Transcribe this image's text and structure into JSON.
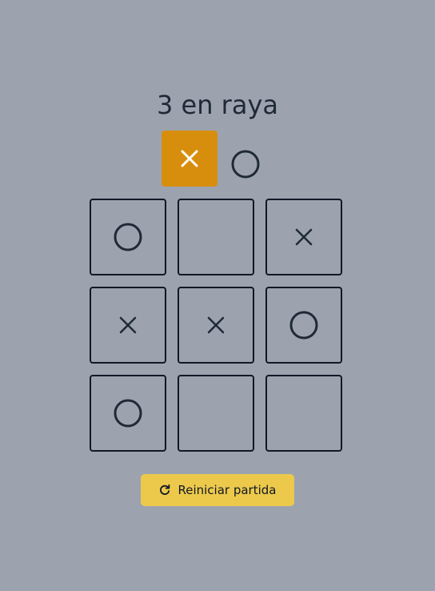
{
  "title": "3 en raya",
  "turn": {
    "current": "X",
    "players": [
      "X",
      "O"
    ],
    "active_color": "#d88e0d"
  },
  "board": [
    "O",
    "",
    "X",
    "X",
    "X",
    "O",
    "O",
    "",
    ""
  ],
  "reset": {
    "label": "Reiniciar partida",
    "icon": "refresh-icon"
  },
  "colors": {
    "background": "#9ca3af",
    "mark": "#1f2937",
    "button": "#ecc94b"
  }
}
